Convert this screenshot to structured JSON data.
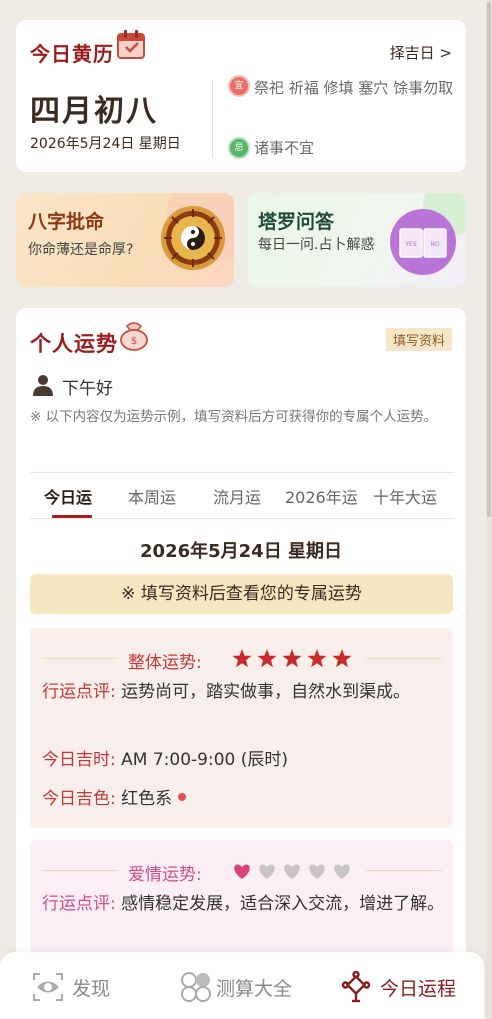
{
  "almanac": {
    "title": "今日黄历",
    "more_label": "择吉日 >",
    "lunar_date": "四月初八",
    "solar_date": "2026年5月24日 星期日",
    "yi_badge": "宜",
    "yi_text": "祭祀 祈福 修填 塞穴 馀事勿取",
    "ji_badge": "忌",
    "ji_text": "诸事不宜"
  },
  "promos": {
    "bazi": {
      "title": "八字批命",
      "subtitle": "你命薄还是命厚?"
    },
    "tarot": {
      "title": "塔罗问答",
      "subtitle": "每日一问.占卜解惑",
      "card_left": "YES",
      "card_right": "NO"
    }
  },
  "fortune": {
    "title": "个人运势",
    "fill_button": "填写资料",
    "greeting": "下午好",
    "note": "※ 以下内容仅为运势示例，填写资料后方可获得你的专属个人运势。",
    "tabs": [
      "今日运",
      "本周运",
      "流月运",
      "2026年运",
      "十年大运"
    ],
    "active_tab": 0,
    "date": "2026年5月24日 星期日",
    "banner": "※ 填写资料后查看您的专属运势",
    "overall": {
      "label": "整体运势:",
      "stars": 5,
      "star_color": "#c82a2a",
      "comment_key": "行运点评:",
      "comment": "运势尚可，踏实做事，自然水到渠成。",
      "time_key": "今日吉时:",
      "time": "AM 7:00-9:00 (辰时)",
      "color_key": "今日吉色:",
      "color": "红色系"
    },
    "love": {
      "label": "爱情运势:",
      "hearts_filled": 1,
      "hearts_total": 5,
      "heart_color": "#d9447c",
      "comment_key": "行运点评:",
      "comment": "感情稳定发展，适合深入交流，增进了解。"
    }
  },
  "nav": {
    "items": [
      {
        "label": "发现",
        "icon": "eye-scan-icon"
      },
      {
        "label": "测算大全",
        "icon": "grid-circles-icon"
      },
      {
        "label": "今日运程",
        "icon": "chinese-knot-icon"
      }
    ],
    "active": 2
  }
}
